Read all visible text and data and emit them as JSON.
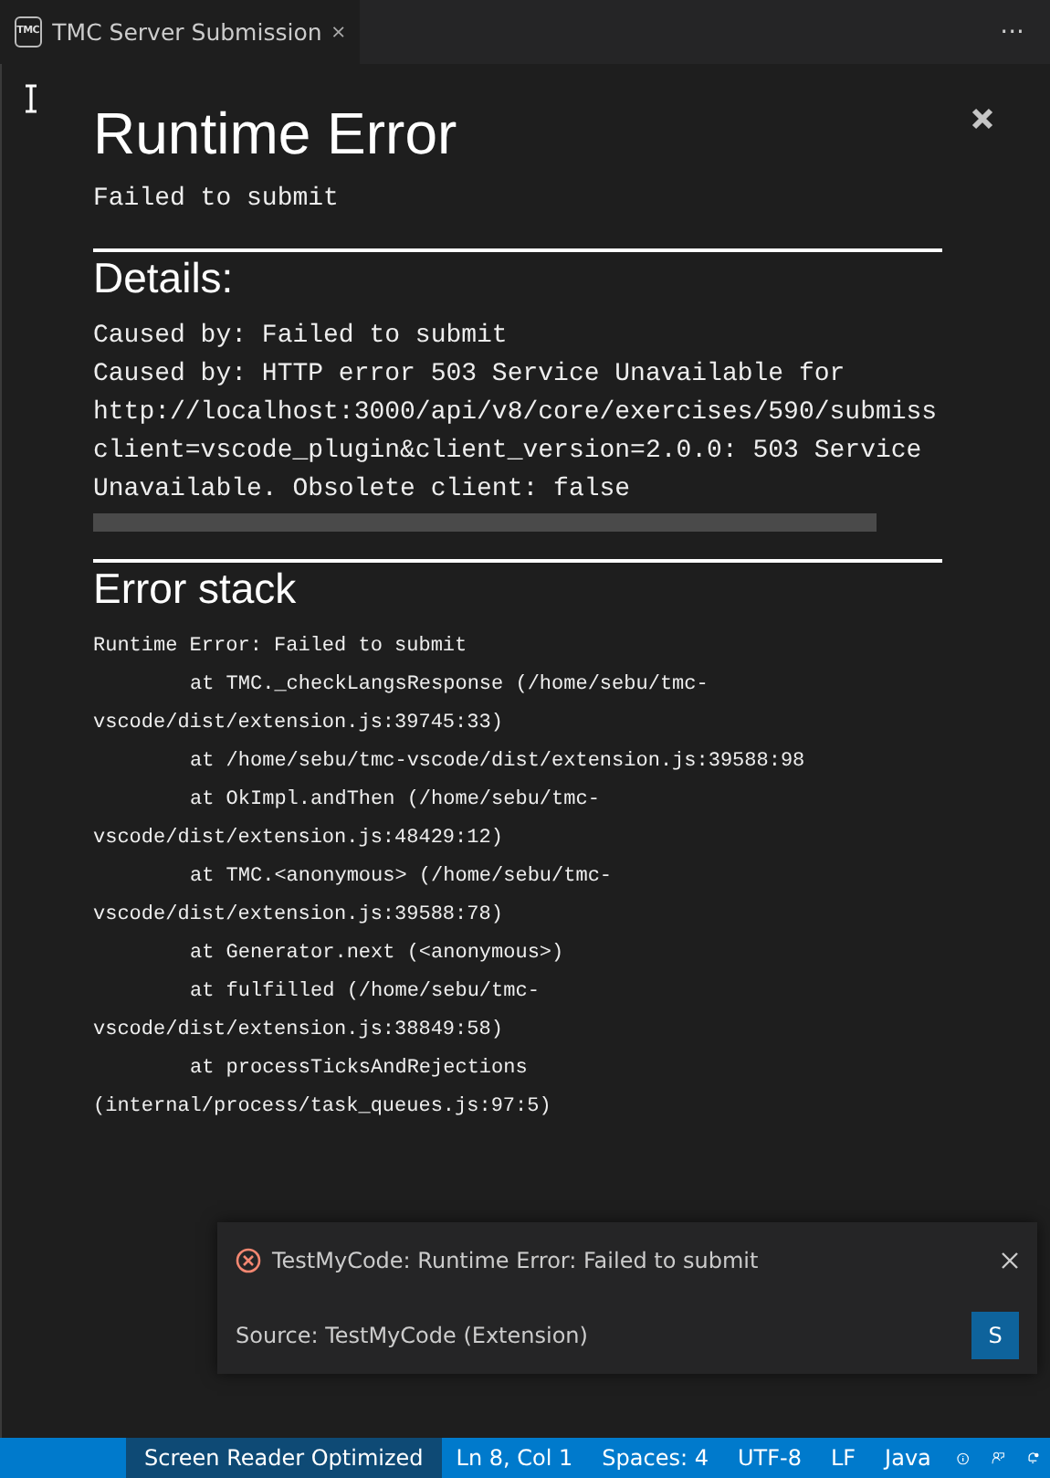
{
  "tab": {
    "logo_text": "TMC",
    "label": "TMC Server Submission",
    "selected": true
  },
  "more": "···",
  "panel": {
    "title": "Runtime Error",
    "message": "Failed to submit",
    "details_heading": "Details:",
    "details": [
      "Caused by: Failed to submit",
      "Caused by: HTTP error 503 Service Unavailable for",
      "http://localhost:3000/api/v8/core/exercises/590/submiss",
      "client=vscode_plugin&client_version=2.0.0: 503 Service",
      "Unavailable. Obsolete client: false"
    ],
    "stack_heading": "Error stack",
    "stack": [
      {
        "kind": "message",
        "text": "Runtime Error: Failed to submit"
      },
      {
        "kind": "frame",
        "text": "at TMC._checkLangsResponse (/home/sebu/tmc-"
      },
      {
        "kind": "continuation",
        "text": "vscode/dist/extension.js:39745:33)"
      },
      {
        "kind": "frame",
        "text": "at /home/sebu/tmc-vscode/dist/extension.js:39588:98"
      },
      {
        "kind": "frame",
        "text": "at OkImpl.andThen (/home/sebu/tmc-"
      },
      {
        "kind": "continuation",
        "text": "vscode/dist/extension.js:48429:12)"
      },
      {
        "kind": "frame",
        "text": "at TMC.<anonymous> (/home/sebu/tmc-"
      },
      {
        "kind": "continuation",
        "text": "vscode/dist/extension.js:39588:78)"
      },
      {
        "kind": "frame",
        "text": "at Generator.next (<anonymous>)"
      },
      {
        "kind": "frame",
        "text": "at fulfilled (/home/sebu/tmc-"
      },
      {
        "kind": "continuation",
        "text": "vscode/dist/extension.js:38849:58)"
      },
      {
        "kind": "frame",
        "text": "at processTicksAndRejections"
      },
      {
        "kind": "continuation",
        "text": "(internal/process/task_queues.js:97:5)"
      }
    ]
  },
  "notification": {
    "message": "TestMyCode: Runtime Error: Failed to submit",
    "source": "Source: TestMyCode (Extension)",
    "button": "S"
  },
  "status_bar": {
    "items": [
      {
        "label": "Screen Reader Optimized",
        "kind": "highlight"
      },
      {
        "label": "Ln 8, Col 1",
        "kind": "text"
      },
      {
        "label": "Spaces: 4",
        "kind": "text"
      },
      {
        "label": "UTF-8",
        "kind": "text"
      },
      {
        "label": "LF",
        "kind": "text"
      },
      {
        "label": "Java",
        "kind": "text"
      }
    ]
  }
}
